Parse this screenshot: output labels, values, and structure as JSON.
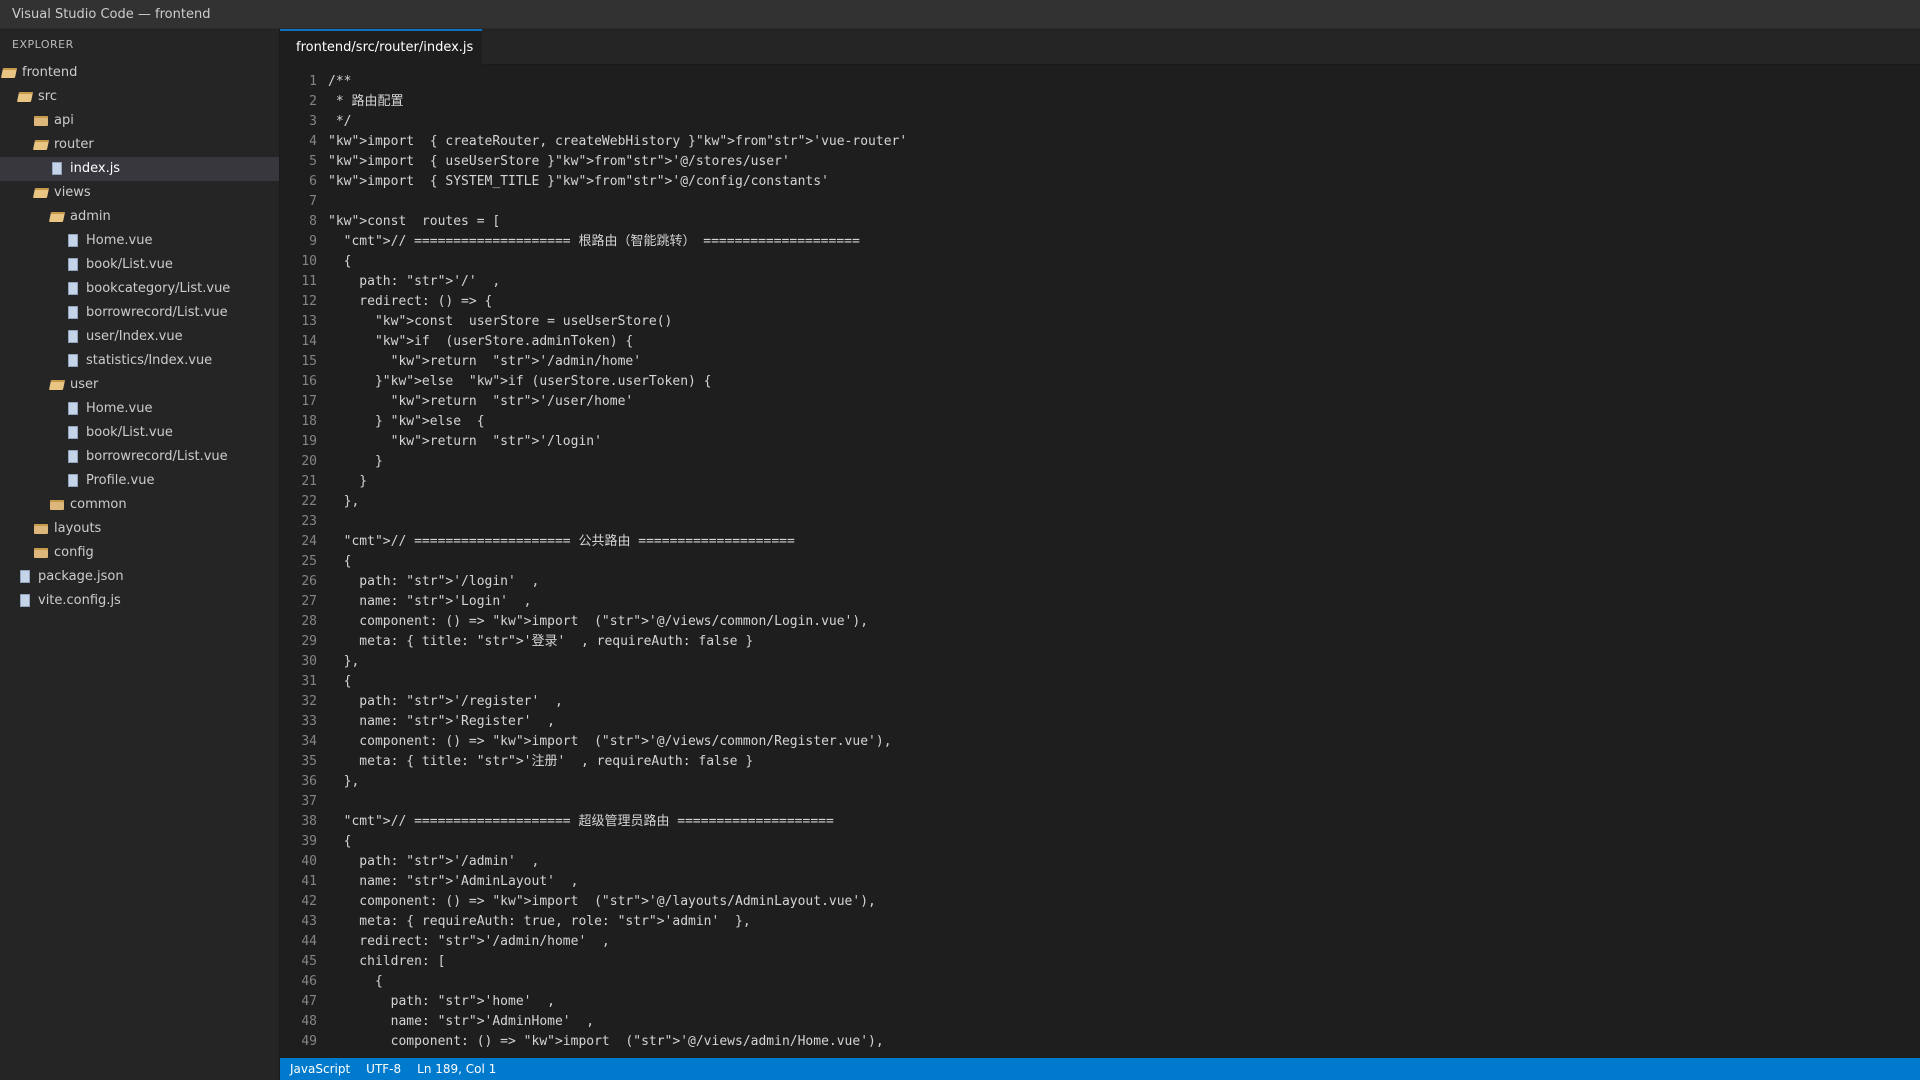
{
  "window": {
    "title": "Visual Studio Code — frontend"
  },
  "sidebar": {
    "header": "EXPLORER",
    "items": [
      {
        "label": "frontend",
        "indent": 0,
        "type": "folder-open"
      },
      {
        "label": "src",
        "indent": 1,
        "type": "folder-open"
      },
      {
        "label": "api",
        "indent": 2,
        "type": "folder"
      },
      {
        "label": "router",
        "indent": 2,
        "type": "folder-open"
      },
      {
        "label": "index.js",
        "indent": 3,
        "type": "file",
        "selected": true
      },
      {
        "label": "views",
        "indent": 2,
        "type": "folder-open"
      },
      {
        "label": "admin",
        "indent": 3,
        "type": "folder-open"
      },
      {
        "label": "Home.vue",
        "indent": 4,
        "type": "file"
      },
      {
        "label": "book/List.vue",
        "indent": 4,
        "type": "file"
      },
      {
        "label": "bookcategory/List.vue",
        "indent": 4,
        "type": "file"
      },
      {
        "label": "borrowrecord/List.vue",
        "indent": 4,
        "type": "file"
      },
      {
        "label": "user/Index.vue",
        "indent": 4,
        "type": "file"
      },
      {
        "label": "statistics/Index.vue",
        "indent": 4,
        "type": "file"
      },
      {
        "label": "user",
        "indent": 3,
        "type": "folder-open"
      },
      {
        "label": "Home.vue",
        "indent": 4,
        "type": "file"
      },
      {
        "label": "book/List.vue",
        "indent": 4,
        "type": "file"
      },
      {
        "label": "borrowrecord/List.vue",
        "indent": 4,
        "type": "file"
      },
      {
        "label": "Profile.vue",
        "indent": 4,
        "type": "file"
      },
      {
        "label": "common",
        "indent": 3,
        "type": "folder"
      },
      {
        "label": "layouts",
        "indent": 2,
        "type": "folder"
      },
      {
        "label": "config",
        "indent": 2,
        "type": "folder"
      },
      {
        "label": "package.json",
        "indent": 1,
        "type": "file"
      },
      {
        "label": "vite.config.js",
        "indent": 1,
        "type": "file"
      }
    ]
  },
  "tabs": [
    {
      "label": "frontend/src/router/index.js",
      "active": true
    }
  ],
  "editor": {
    "lines": [
      "/**",
      " * 路由配置",
      " */",
      "\"kw\">import  { createRouter, createWebHistory }\"kw\">from\"str\">'vue-router'",
      "\"kw\">import  { useUserStore }\"kw\">from\"str\">'@/stores/user'",
      "\"kw\">import  { SYSTEM_TITLE }\"kw\">from\"str\">'@/config/constants'",
      "",
      "\"kw\">const  routes = [",
      "  \"cmt\">// ==================== 根路由（智能跳转） ====================",
      "  {",
      "    path: \"str\">'/'  ,",
      "    redirect: () => {",
      "      \"kw\">const  userStore = useUserStore()",
      "      \"kw\">if  (userStore.adminToken) {",
      "        \"kw\">return  \"str\">'/admin/home'",
      "      }\"kw\">else  \"kw\">if (userStore.userToken) {",
      "        \"kw\">return  \"str\">'/user/home'",
      "      } \"kw\">else  {",
      "        \"kw\">return  \"str\">'/login'",
      "      }",
      "    }",
      "  },",
      "",
      "  \"cmt\">// ==================== 公共路由 ====================",
      "  {",
      "    path: \"str\">'/login'  ,",
      "    name: \"str\">'Login'  ,",
      "    component: () => \"kw\">import  (\"str\">'@/views/common/Login.vue'),",
      "    meta: { title: \"str\">'登录'  , requireAuth: false }",
      "  },",
      "  {",
      "    path: \"str\">'/register'  ,",
      "    name: \"str\">'Register'  ,",
      "    component: () => \"kw\">import  (\"str\">'@/views/common/Register.vue'),",
      "    meta: { title: \"str\">'注册'  , requireAuth: false }",
      "  },",
      "",
      "  \"cmt\">// ==================== 超级管理员路由 ====================",
      "  {",
      "    path: \"str\">'/admin'  ,",
      "    name: \"str\">'AdminLayout'  ,",
      "    component: () => \"kw\">import  (\"str\">'@/layouts/AdminLayout.vue'),",
      "    meta: { requireAuth: true, role: \"str\">'admin'  },",
      "    redirect: \"str\">'/admin/home'  ,",
      "    children: [",
      "      {",
      "        path: \"str\">'home'  ,",
      "        name: \"str\">'AdminHome'  ,",
      "        component: () => \"kw\">import  (\"str\">'@/views/admin/Home.vue'),"
    ]
  },
  "statusbar": {
    "language": "JavaScript",
    "encoding": "UTF-8",
    "cursor": "Ln 189, Col 1"
  },
  "colors": {
    "accent": "#007acc",
    "tab_indicator": "#0e70c0",
    "folder": "#dcb67a",
    "editor_bg": "#1e1e1e",
    "sidebar_bg": "#252526"
  }
}
